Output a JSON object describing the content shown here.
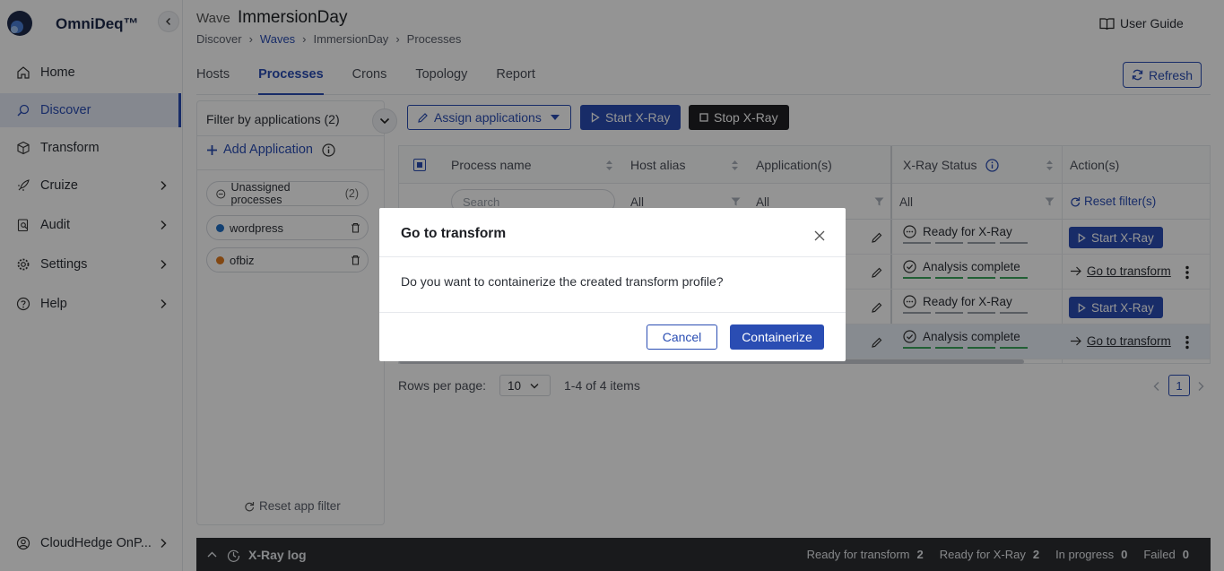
{
  "app": {
    "name": "OmniDeq™"
  },
  "sidebar": {
    "items": [
      {
        "label": "Home"
      },
      {
        "label": "Discover"
      },
      {
        "label": "Transform"
      },
      {
        "label": "Cruize"
      },
      {
        "label": "Audit"
      },
      {
        "label": "Settings"
      },
      {
        "label": "Help"
      }
    ],
    "user": "CloudHedge OnP..."
  },
  "header": {
    "wave_prefix": "Wave",
    "wave_name": "ImmersionDay",
    "breadcrumb": [
      "Discover",
      "Waves",
      "ImmersionDay",
      "Processes"
    ],
    "user_guide": "User Guide"
  },
  "tabs": [
    "Hosts",
    "Processes",
    "Crons",
    "Topology",
    "Report"
  ],
  "refresh_label": "Refresh",
  "filter_panel": {
    "title": "Filter by applications (2)",
    "add_app": "Add Application",
    "unassigned": "Unassigned processes",
    "unassigned_count": "(2)",
    "apps": [
      {
        "name": "wordpress",
        "color": "#1f6fc4"
      },
      {
        "name": "ofbiz",
        "color": "#e07a1f"
      }
    ],
    "reset": "Reset app filter"
  },
  "toolbar": {
    "assign": "Assign applications",
    "start": "Start X-Ray",
    "stop": "Stop X-Ray"
  },
  "table": {
    "headers": [
      "Process name",
      "Host alias",
      "Application(s)",
      "X-Ray Status",
      "Action(s)"
    ],
    "search_placeholder": "Search",
    "filter_all": "All",
    "reset_filters": "Reset filter(s)",
    "rows": [
      {
        "status": "Ready for X-Ray",
        "action": "Start X-Ray"
      },
      {
        "status": "Analysis complete",
        "action": "Go to transform"
      },
      {
        "status": "Ready for X-Ray",
        "action": "Start X-Ray"
      },
      {
        "status": "Analysis complete",
        "action": "Go to transform"
      }
    ]
  },
  "pager": {
    "label": "Rows per page:",
    "size": "10",
    "count": "1-4 of 4 items",
    "page": "1"
  },
  "log": {
    "title": "X-Ray log",
    "stats": [
      {
        "label": "Ready for transform",
        "value": "2"
      },
      {
        "label": "Ready for X-Ray",
        "value": "2"
      },
      {
        "label": "In progress",
        "value": "0"
      },
      {
        "label": "Failed",
        "value": "0"
      }
    ]
  },
  "modal": {
    "title": "Go to transform",
    "body": "Do you want to containerize the created transform profile?",
    "cancel": "Cancel",
    "confirm": "Containerize"
  },
  "colors": {
    "primary": "#2a4db3",
    "dark": "#1f2023",
    "success": "#3ba55c"
  }
}
